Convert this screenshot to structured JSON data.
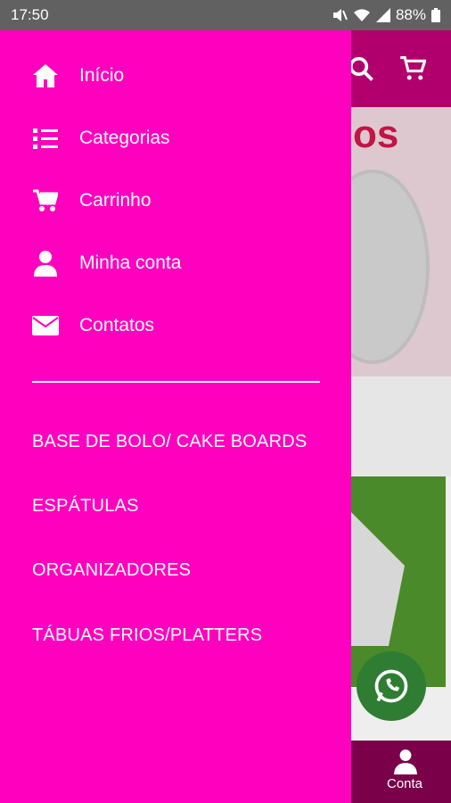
{
  "status": {
    "time": "17:50",
    "battery": "88%"
  },
  "drawer": {
    "items": [
      {
        "label": "Início",
        "icon": "home-icon"
      },
      {
        "label": "Categorias",
        "icon": "list-icon"
      },
      {
        "label": "Carrinho",
        "icon": "cart-icon"
      },
      {
        "label": "Minha conta",
        "icon": "user-icon"
      },
      {
        "label": "Contatos",
        "icon": "mail-icon"
      }
    ],
    "categories": [
      "BASE DE BOLO/ CAKE BOARDS",
      "ESPÁTULAS",
      "ORGANIZADORES",
      "TÁBUAS FRIOS/PLATTERS"
    ]
  },
  "background": {
    "banner_text": "os",
    "bottom_nav_label": "Conta"
  },
  "colors": {
    "drawer": "#ff00bf",
    "appbar": "#b1006d"
  }
}
